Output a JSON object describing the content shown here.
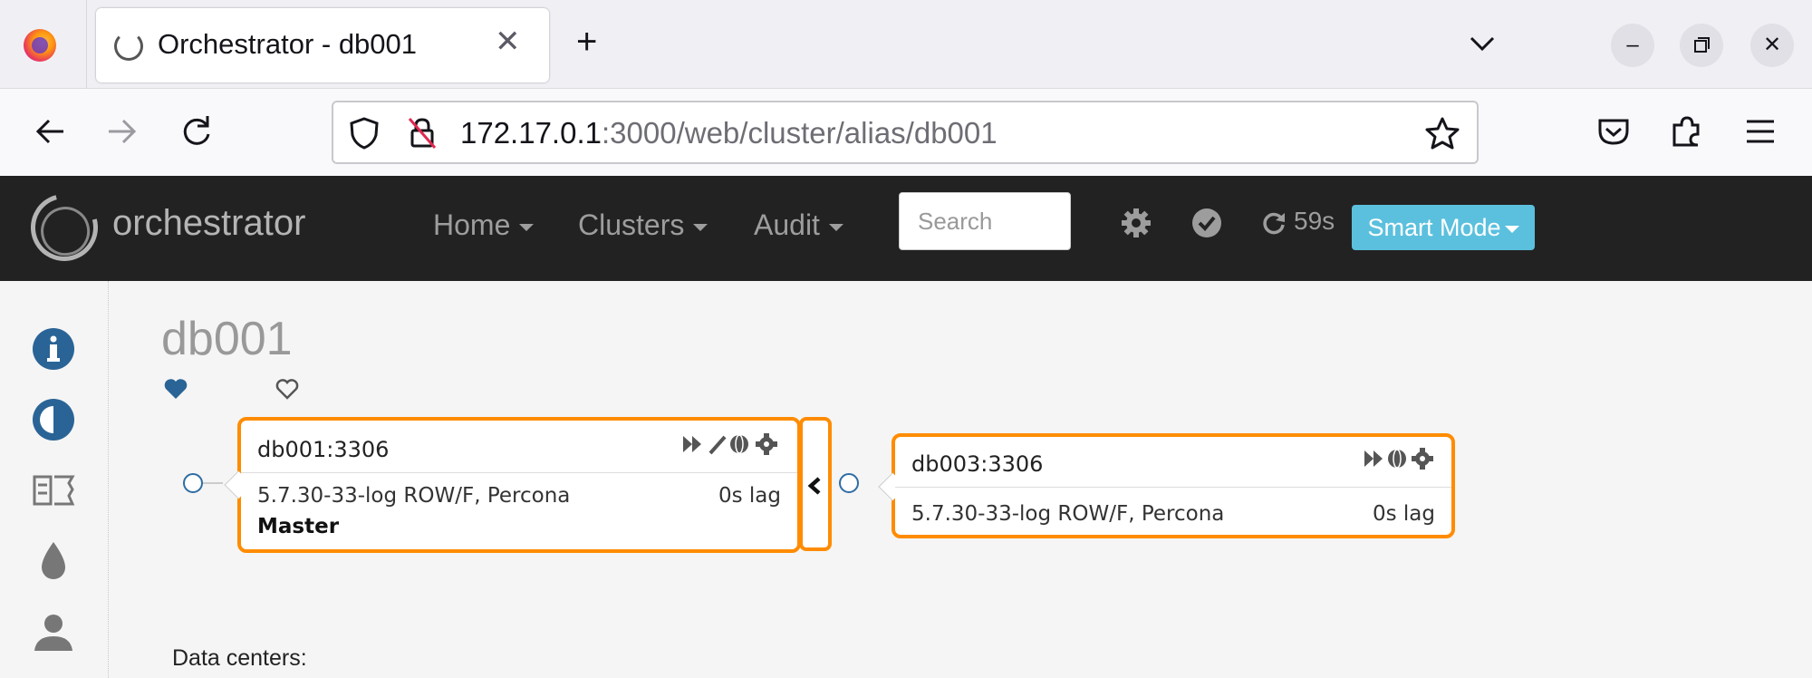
{
  "browser": {
    "tab_title": "Orchestrator - db001",
    "url_host": "172.17.0.1",
    "url_rest": ":3000/web/cluster/alias/db001"
  },
  "app": {
    "brand": "orchestrator",
    "menus": [
      {
        "label": "Home"
      },
      {
        "label": "Clusters"
      },
      {
        "label": "Audit"
      }
    ],
    "search_placeholder": "Search",
    "refresh_countdown": "59s",
    "mode_button": "Smart Mode"
  },
  "page": {
    "title": "db001",
    "data_centers_label": "Data centers:"
  },
  "nodes": [
    {
      "name": "db001:3306",
      "version": "5.7.30-33-log ROW/F, Percona",
      "lag": "0s lag",
      "role": "Master"
    },
    {
      "name": "db003:3306",
      "version": "5.7.30-33-log ROW/F, Percona",
      "lag": "0s lag",
      "role": ""
    }
  ],
  "colors": {
    "accent_orange": "#ff8c00",
    "sidebar_blue": "#2a6496",
    "smart_mode": "#5bc0de",
    "appbar": "#222222"
  },
  "icons": [
    "info-icon",
    "contrast-icon",
    "list-icon",
    "drop-icon",
    "user-icon",
    "heart-icon",
    "heart-outline-icon",
    "gear-icon",
    "check-circle-icon",
    "refresh-icon"
  ]
}
